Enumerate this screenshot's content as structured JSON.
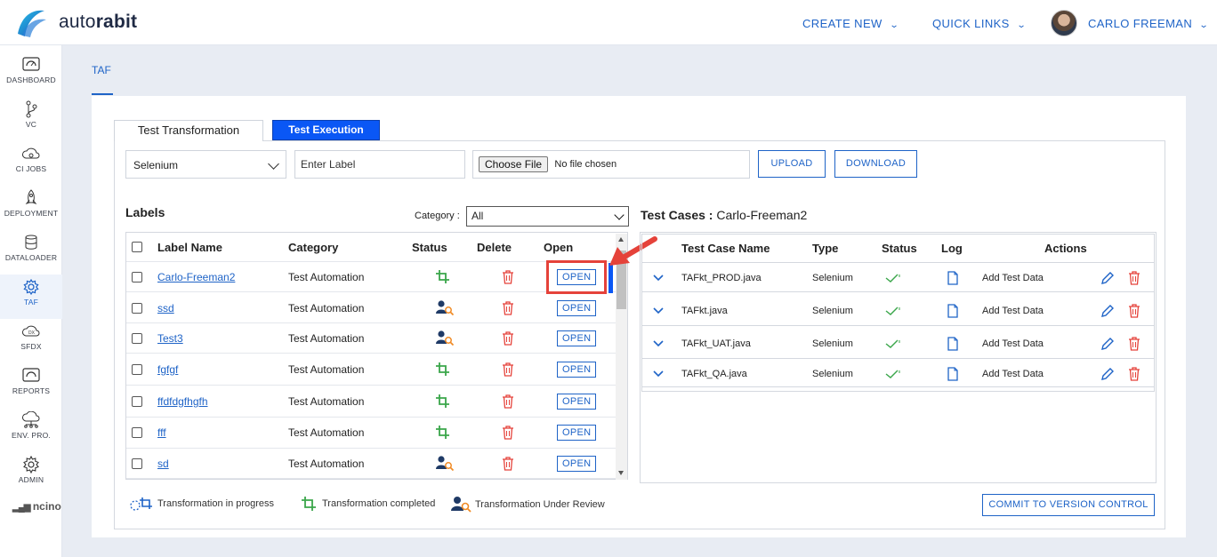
{
  "brand": {
    "name_light": "auto",
    "name_bold": "rabit"
  },
  "header": {
    "nav": [
      {
        "label": "CREATE NEW"
      },
      {
        "label": "QUICK LINKS"
      }
    ],
    "user_name": "CARLO FREEMAN"
  },
  "sidebar": {
    "items": [
      {
        "label": "DASHBOARD",
        "icon": "dashboard-icon"
      },
      {
        "label": "VC",
        "icon": "branch-icon"
      },
      {
        "label": "CI JOBS",
        "icon": "cloud-gear-icon"
      },
      {
        "label": "DEPLOYMENT",
        "icon": "rocket-icon"
      },
      {
        "label": "DATALOADER",
        "icon": "database-icon"
      },
      {
        "label": "TAF",
        "icon": "gear-icon",
        "active": true
      },
      {
        "label": "SFDX",
        "icon": "dx-cloud-icon"
      },
      {
        "label": "REPORTS",
        "icon": "report-icon"
      },
      {
        "label": "ENV. PRO.",
        "icon": "cloud-network-icon"
      },
      {
        "label": "ADMIN",
        "icon": "gear-outline-icon"
      }
    ],
    "footer_brand": "ncino"
  },
  "page": {
    "tab": "TAF"
  },
  "tabs": {
    "transformation": "Test Transformation",
    "execution": "Test Execution"
  },
  "toolbar": {
    "framework_value": "Selenium",
    "label_placeholder": "Enter Label",
    "choose_file": "Choose File",
    "no_file": "No file chosen",
    "upload": "UPLOAD",
    "download": "DOWNLOAD"
  },
  "labels": {
    "title": "Labels",
    "category_label": "Category :",
    "category_value": "All",
    "columns": {
      "name": "Label Name",
      "category": "Category",
      "status": "Status",
      "delete": "Delete",
      "open": "Open"
    },
    "open_label": "OPEN",
    "rows": [
      {
        "name": "Carlo-Freeman2",
        "category": "Test Automation",
        "status": "completed"
      },
      {
        "name": "ssd",
        "category": "Test Automation",
        "status": "review"
      },
      {
        "name": "Test3",
        "category": "Test Automation",
        "status": "review"
      },
      {
        "name": "fgfgf",
        "category": "Test Automation",
        "status": "completed"
      },
      {
        "name": "ffdfdgfhgfh",
        "category": "Test Automation",
        "status": "completed"
      },
      {
        "name": "fff",
        "category": "Test Automation",
        "status": "completed"
      },
      {
        "name": "sd",
        "category": "Test Automation",
        "status": "review"
      }
    ]
  },
  "legend": {
    "in_progress": "Transformation in progress",
    "completed": "Transformation completed",
    "review": "Transformation Under Review"
  },
  "test_cases": {
    "title_prefix": "Test Cases :",
    "title_label": "Carlo-Freeman2",
    "columns": {
      "name": "Test Case Name",
      "type": "Type",
      "status": "Status",
      "log": "Log",
      "actions": "Actions"
    },
    "add_test_data": "Add Test Data",
    "rows": [
      {
        "name": "TAFkt_PROD.java",
        "type": "Selenium"
      },
      {
        "name": "TAFkt.java",
        "type": "Selenium"
      },
      {
        "name": "TAFkt_UAT.java",
        "type": "Selenium"
      },
      {
        "name": "TAFkt_QA.java",
        "type": "Selenium"
      }
    ],
    "commit": "COMMIT TO VERSION CONTROL"
  },
  "colors": {
    "accent": "#1e63c7",
    "tab_active": "#0a57f5",
    "success": "#3aa64a",
    "danger": "#e5423a",
    "review_orange": "#f08a24"
  }
}
